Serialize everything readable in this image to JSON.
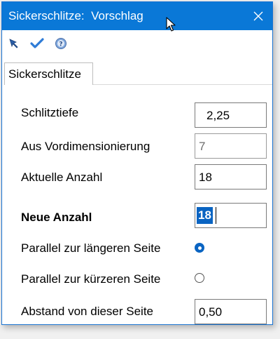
{
  "window": {
    "title": "Sickerschlitze:  Vorschlag"
  },
  "toolbar": {
    "icons": [
      "pointer-arrow-icon",
      "checkmark-icon",
      "help-icon"
    ]
  },
  "tab": {
    "label": "Sickerschlitze"
  },
  "fields": {
    "schlitztiefe": {
      "label": "Schlitztiefe",
      "value": "2,25"
    },
    "vordim": {
      "label": "Aus Vordimensionierung",
      "value": "7"
    },
    "aktuelle": {
      "label": "Aktuelle Anzahl",
      "value": "18"
    },
    "neue": {
      "label": "Neue Anzahl",
      "value": "18"
    },
    "abstand": {
      "label": "Abstand von dieser Seite",
      "value": "0,50"
    }
  },
  "radios": {
    "laenger": {
      "label": "Parallel zur längeren Seite",
      "checked": true
    },
    "kuerzer": {
      "label": "Parallel zur kürzeren Seite",
      "checked": false
    }
  },
  "colors": {
    "titlebar": "#0a78d7",
    "accent": "#0a64c2"
  }
}
